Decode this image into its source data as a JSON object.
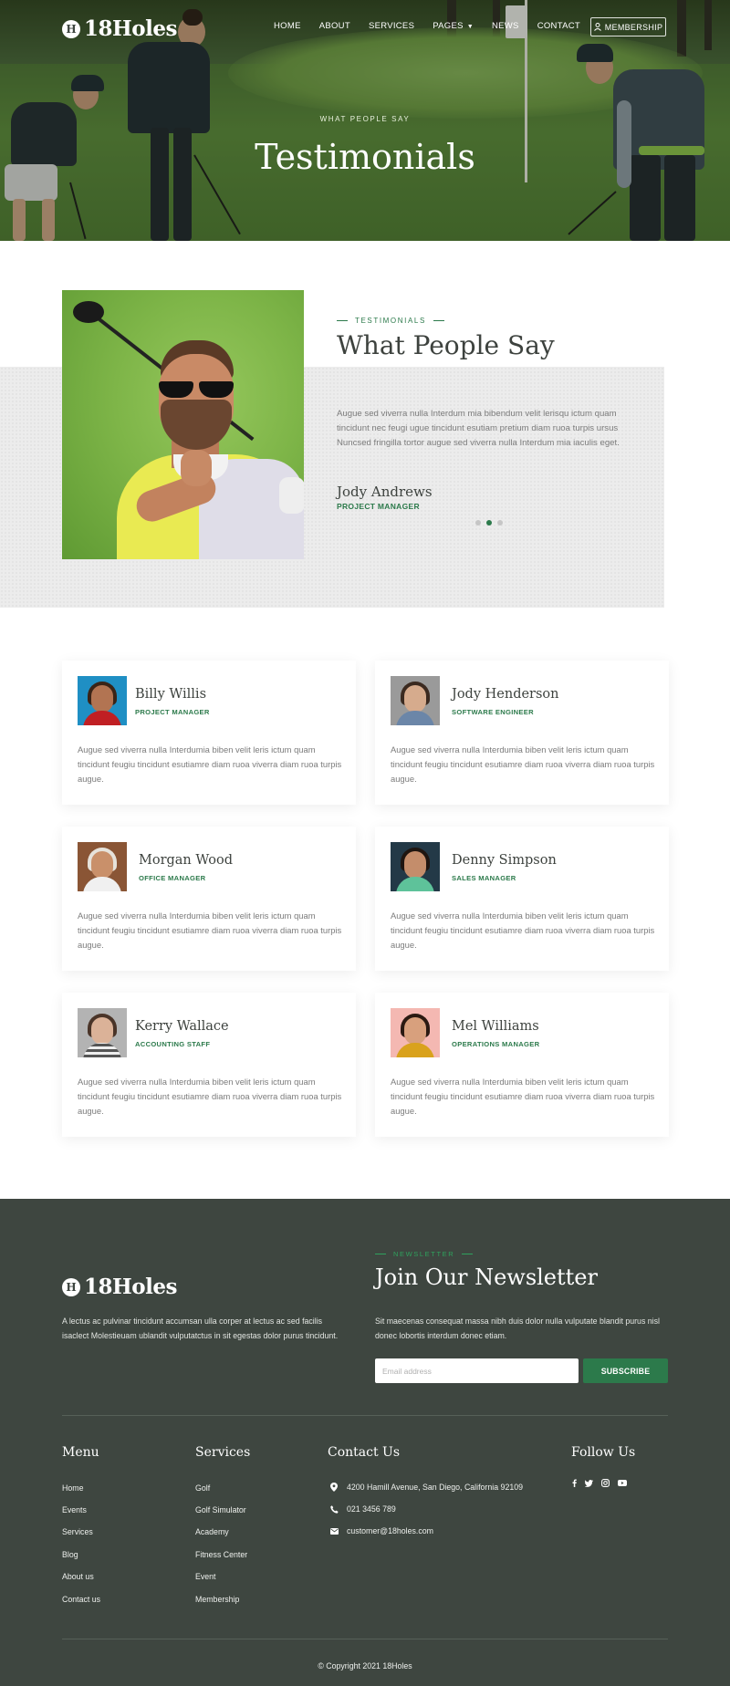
{
  "brand": {
    "logo_badge": "H",
    "name": "18Holes"
  },
  "nav": {
    "items": [
      "HOME",
      "ABOUT",
      "SERVICES",
      "PAGES",
      "NEWS",
      "CONTACT"
    ],
    "membership": "MEMBERSHIP"
  },
  "hero": {
    "eyebrow": "WHAT PEOPLE SAY",
    "title": "Testimonials"
  },
  "featured": {
    "eyebrow": "TESTIMONIALS",
    "heading": "What People Say",
    "quote": "Augue sed viverra nulla Interdum mia bibendum velit lerisqu ictum quam tincidunt nec feugi ugue tincidunt esutiam pretium diam ruoa turpis ursus Nuncsed fringilla tortor augue sed viverra nulla Interdum mia iaculis eget.",
    "name": "Jody Andrews",
    "role": "PROJECT MANAGER",
    "slides": 3,
    "active_slide": 2
  },
  "testimonials": [
    {
      "name": "Billy Willis",
      "role": "PROJECT MANAGER",
      "text": "Augue sed viverra nulla Interdumia biben velit leris ictum quam tincidunt feugiu tincidunt esutiamre diam ruoa viverra diam ruoa turpis augue."
    },
    {
      "name": "Jody Henderson",
      "role": "SOFTWARE ENGINEER",
      "text": "Augue sed viverra nulla Interdumia biben velit leris ictum quam tincidunt feugiu tincidunt esutiamre diam ruoa viverra diam ruoa turpis augue."
    },
    {
      "name": "Morgan Wood",
      "role": "OFFICE MANAGER",
      "text": "Augue sed viverra nulla Interdumia biben velit leris ictum quam tincidunt feugiu tincidunt esutiamre diam ruoa viverra diam ruoa turpis augue."
    },
    {
      "name": "Denny Simpson",
      "role": "SALES MANAGER",
      "text": "Augue sed viverra nulla Interdumia biben velit leris ictum quam tincidunt feugiu tincidunt esutiamre diam ruoa viverra diam ruoa turpis augue."
    },
    {
      "name": "Kerry Wallace",
      "role": "ACCOUNTING STAFF",
      "text": "Augue sed viverra nulla Interdumia biben velit leris ictum quam tincidunt feugiu tincidunt esutiamre diam ruoa viverra diam ruoa turpis augue."
    },
    {
      "name": "Mel Williams",
      "role": "OPERATIONS MANAGER",
      "text": "Augue sed viverra nulla Interdumia biben velit leris ictum quam tincidunt feugiu tincidunt esutiamre diam ruoa viverra diam ruoa turpis augue."
    }
  ],
  "footer": {
    "about": "A lectus ac pulvinar tincidunt accumsan ulla corper at lectus ac sed facilis isaclect Molestieuam ublandit vulputatctus in sit egestas dolor purus tincidunt.",
    "newsletter": {
      "eyebrow": "NEWSLETTER",
      "title": "Join Our Newsletter",
      "text": "Sit maecenas consequat massa nibh duis dolor nulla vulputate blandit purus nisl donec lobortis interdum donec etiam.",
      "placeholder": "Email address",
      "button": "SUBSCRIBE"
    },
    "menu": {
      "title": "Menu",
      "links": [
        "Home",
        "Events",
        "Services",
        "Blog",
        "About us",
        "Contact us"
      ]
    },
    "services": {
      "title": "Services",
      "links": [
        "Golf",
        "Golf Simulator",
        "Academy",
        "Fitness Center",
        "Event",
        "Membership"
      ]
    },
    "contact": {
      "title": "Contact Us",
      "address": "4200 Hamill Avenue, San Diego, California 92109",
      "phone": "021 3456 789",
      "email": "customer@18holes.com"
    },
    "follow": {
      "title": "Follow Us",
      "icons": [
        "facebook-icon",
        "twitter-icon",
        "instagram-icon",
        "youtube-icon"
      ]
    },
    "copyright": "© Copyright 2021 18Holes"
  },
  "colors": {
    "accent": "#2c7a4b",
    "footer_bg": "#3e4640",
    "panel_bg": "#ececec"
  }
}
